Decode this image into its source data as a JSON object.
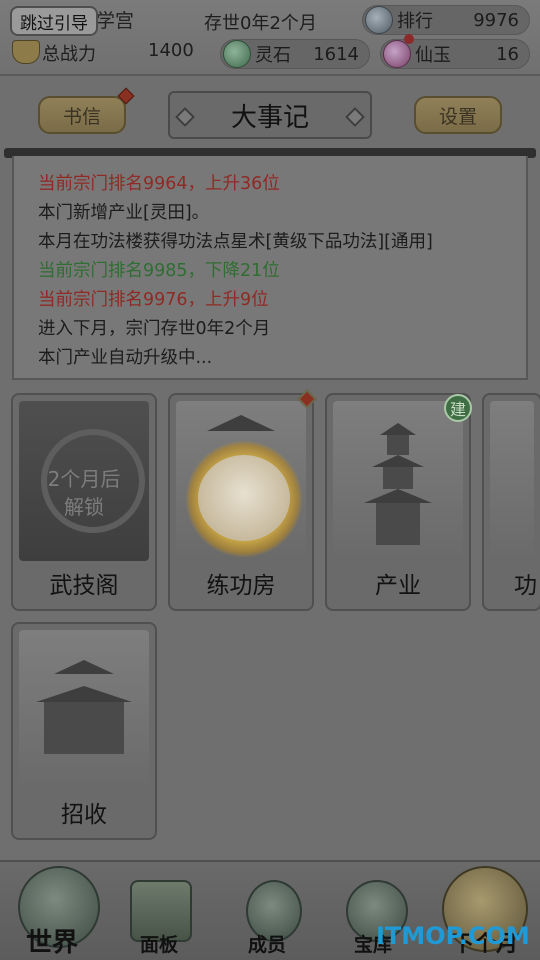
{
  "topbar": {
    "skip_guide": "跳过引导",
    "sect_name": "学宫",
    "power_label": "总战力",
    "power_value": "1400",
    "age_text": "存世0年2个月",
    "rank_label": "排行",
    "rank_value": "9976",
    "stone_label": "灵石",
    "stone_value": "1614",
    "jade_label": "仙玉",
    "jade_value": "16"
  },
  "header": {
    "mail_label": "书信",
    "title": "大事记",
    "settings_label": "设置"
  },
  "log": {
    "lines": [
      {
        "text": "当前宗门排名9964，上升36位",
        "tone": "red"
      },
      {
        "text": "本门新增产业[灵田]。",
        "tone": "dark"
      },
      {
        "text": "本月在功法楼获得功法点星术[黄级下品功法][通用]",
        "tone": "dark"
      },
      {
        "text": "当前宗门排名9985，下降21位",
        "tone": "green"
      },
      {
        "text": "当前宗门排名9976，上升9位",
        "tone": "red"
      },
      {
        "text": "进入下月，宗门存世0年2个月",
        "tone": "dark"
      },
      {
        "text": "本门产业自动升级中...",
        "tone": "dark"
      }
    ]
  },
  "buildings": [
    {
      "label": "武技阁",
      "lock_text_1": "2个月后",
      "lock_text_2": "解锁"
    },
    {
      "label": "练功房"
    },
    {
      "label": "产业",
      "badge": "建"
    },
    {
      "label": "功"
    },
    {
      "label": "招收"
    }
  ],
  "nav": {
    "world": "世界",
    "panel": "面板",
    "members": "成员",
    "vault": "宝库",
    "next": "下个月"
  },
  "watermark": "ITMOP.COM",
  "colors": {
    "log_red": "#8f2a24",
    "log_green": "#2f6e32",
    "watermark": "#1f9ad6"
  }
}
